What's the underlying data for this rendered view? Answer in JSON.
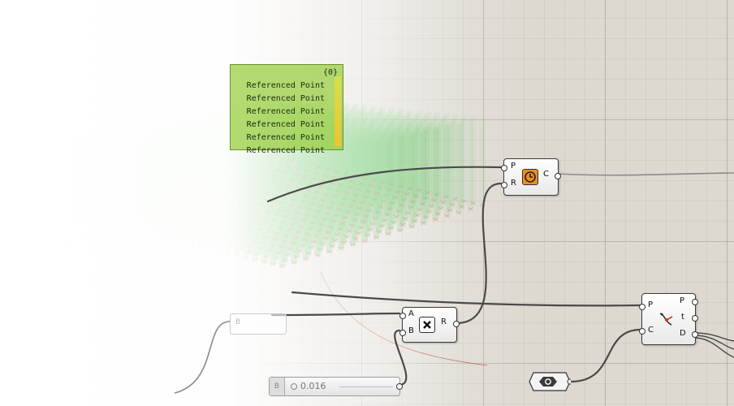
{
  "panel": {
    "header": "{0}",
    "rows": [
      "Referenced Point",
      "Referenced Point",
      "Referenced Point",
      "Referenced Point",
      "Referenced Point",
      "Referenced Point"
    ]
  },
  "component_closest": {
    "inputs": [
      "P",
      "R"
    ],
    "outputs": [
      "C"
    ],
    "icon": "clock-icon",
    "icon_color": "#f08c1e"
  },
  "component_multiply": {
    "inputs": [
      "A",
      "B"
    ],
    "outputs": [
      "R"
    ],
    "icon": "multiply-icon"
  },
  "component_curve_closest": {
    "inputs": [
      "P",
      "C"
    ],
    "outputs": [
      "P",
      "t",
      "D"
    ],
    "icon": "curve-point-icon"
  },
  "slider": {
    "tag": "B",
    "value": "0.016"
  },
  "ghost_param": {
    "label": "B"
  },
  "hex_param": {
    "icon": "hexagon-nut-icon"
  },
  "colors": {
    "cylinder_green": "#3dbb3a",
    "point_red": "#b3261e",
    "wire": "#4a4a4a",
    "canvas": "#ddd9d1"
  }
}
